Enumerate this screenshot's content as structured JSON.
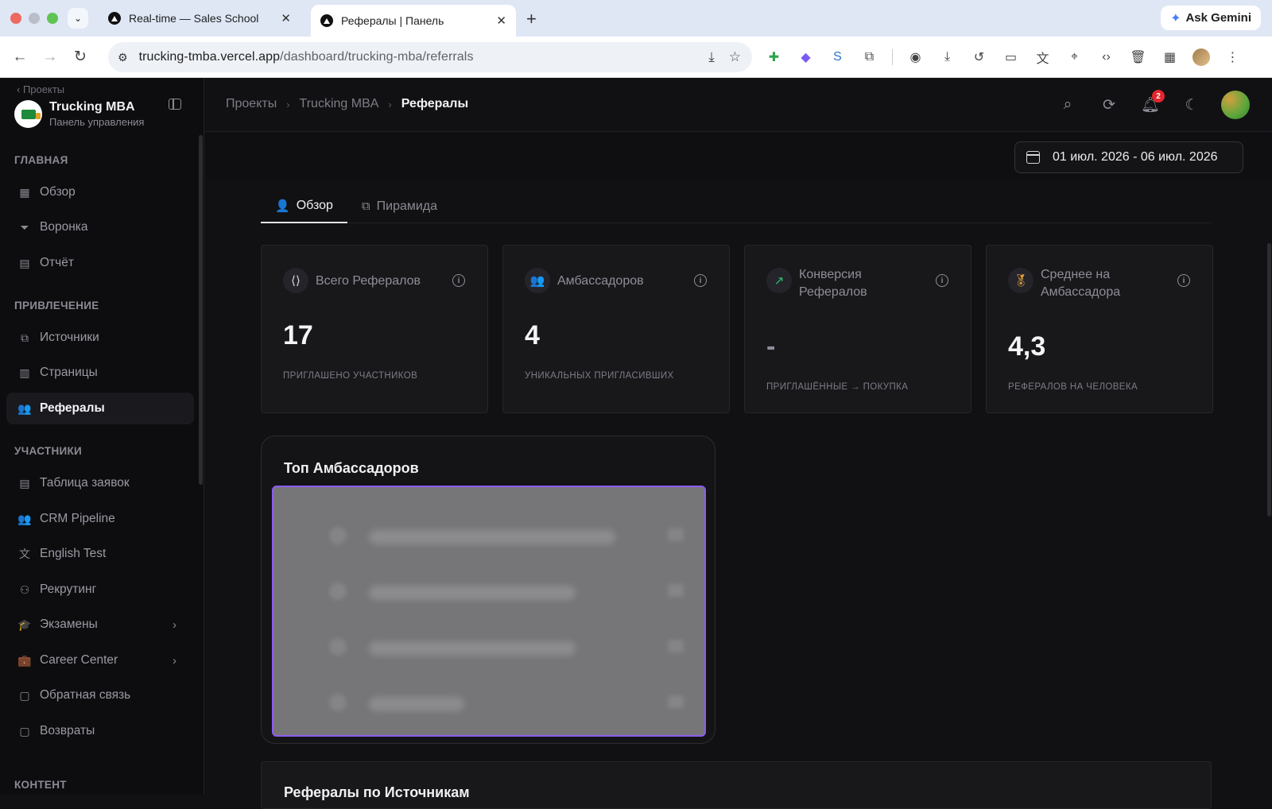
{
  "browser": {
    "tabs": [
      {
        "title": "Real-time — Sales School"
      },
      {
        "title": "Рефералы | Панель"
      }
    ],
    "gemini_label": "Ask Gemini",
    "url_host": "trucking-tmba.vercel.app",
    "url_path": "/dashboard/trucking-mba/referrals"
  },
  "sidebar": {
    "back_label": "Проекты",
    "brand_title": "Trucking MBA",
    "brand_subtitle": "Панель управления",
    "sections": [
      {
        "label": "ГЛАВНАЯ"
      },
      {
        "label": "ПРИВЛЕЧЕНИЕ"
      },
      {
        "label": "УЧАСТНИКИ"
      },
      {
        "label": "КОНТЕНТ"
      }
    ],
    "items": [
      {
        "label": "Обзор",
        "icon": "grid-icon"
      },
      {
        "label": "Воронка",
        "icon": "funnel-icon"
      },
      {
        "label": "Отчёт",
        "icon": "report-icon"
      },
      {
        "label": "Источники",
        "icon": "sources-icon"
      },
      {
        "label": "Страницы",
        "icon": "pages-icon"
      },
      {
        "label": "Рефералы",
        "icon": "users-icon"
      },
      {
        "label": "Таблица заявок",
        "icon": "document-icon"
      },
      {
        "label": "CRM Pipeline",
        "icon": "users-icon"
      },
      {
        "label": "English Test",
        "icon": "translate-icon"
      },
      {
        "label": "Рекрутинг",
        "icon": "user-plus-icon"
      },
      {
        "label": "Экзамены",
        "icon": "graduation-icon"
      },
      {
        "label": "Career Center",
        "icon": "briefcase-icon"
      },
      {
        "label": "Обратная связь",
        "icon": "message-icon"
      },
      {
        "label": "Возвраты",
        "icon": "message-icon"
      }
    ]
  },
  "breadcrumb": {
    "items": [
      "Проекты",
      "Trucking MBA",
      "Рефералы"
    ]
  },
  "notifications_count": "2",
  "date_range": "01 июл. 2026 - 06 июл. 2026",
  "view_tabs": [
    {
      "label": "Обзор"
    },
    {
      "label": "Пирамида"
    }
  ],
  "stat_cards": [
    {
      "title": "Всего Рефералов",
      "value": "17",
      "subtitle": "Приглашено участников",
      "icon": "share-icon"
    },
    {
      "title": "Амбассадоров",
      "value": "4",
      "subtitle": "Уникальных пригласивших",
      "icon": "users-icon"
    },
    {
      "title": "Конверсия Рефералов",
      "value": "-",
      "subtitle": "Приглашённые → Покупка",
      "icon": "trending-up-icon"
    },
    {
      "title": "Среднее на Амбассадора",
      "value": "4,3",
      "subtitle": "Рефералов на человека",
      "icon": "award-icon"
    }
  ],
  "top_ambassadors": {
    "title": "Топ Амбассадоров"
  },
  "by_sources": {
    "title": "Рефералы по Источникам"
  },
  "colors": {
    "accent_purple": "#8d5cf0",
    "badge_red": "#e5262d",
    "trend_green": "#25c26e",
    "award_orange": "#e6a23c"
  }
}
